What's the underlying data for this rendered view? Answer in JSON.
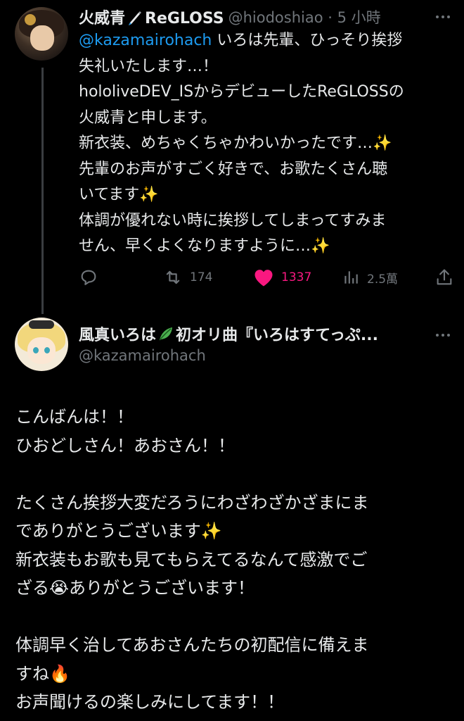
{
  "parent_tweet": {
    "display_name_part1": "火威青",
    "display_name_part2": "ReGLOSS",
    "handle_meta": "@hiodoshiao · 5 小時",
    "mention": "@kazamairohach",
    "body_after_mention": " いろは先輩、ひっそり挨拶\n失礼いたします…！\nhololiveDEV_ISからデビューしたReGLOSSの\n火威青と申します。\n新衣装、めちゃくちゃかわいかったです…",
    "line6_end": "✨",
    "line7": "\n先輩のお声がすごく好きで、お歌たくさん聴\nいてます",
    "line8_end": "✨",
    "line9": "\n体調が優れない時に挨拶してしまってすみま\nせん、早くよくなりますように…",
    "line10_end": "✨",
    "actions": {
      "retweets": "174",
      "likes": "1337",
      "views": "2.5萬"
    },
    "like_color": "#f91880",
    "mention_color": "#1d9bf0"
  },
  "reply_tweet": {
    "name_part1": "風真いろは",
    "name_part2": "初オリ曲『いろはすてっぷ...",
    "handle": "@kazamairohach",
    "body_a": "こんばんは！！\nひおどしさん！あおさん！！\n\nたくさん挨拶大変だろうにわざわざかざまにま\nでありがとうございます",
    "spark1": "✨",
    "body_b": "\n新衣装もお歌も見てもらえてるなんて感激でご\nざる",
    "crying_emoji": "😭",
    "body_c": "ありがとうございます！\n\n体調早く治してあおさんたちの初配信に備えま\nすね",
    "fire_emoji": "🔥",
    "body_d": "\nお声聞けるの楽しみにしてます！！"
  }
}
